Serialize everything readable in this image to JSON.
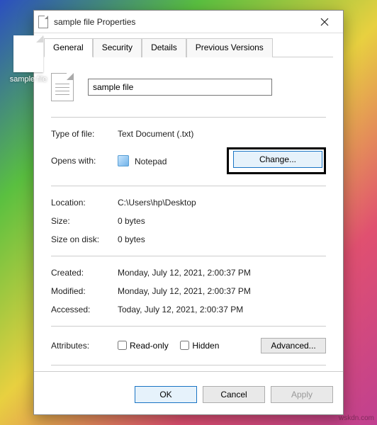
{
  "desktop": {
    "file_label": "sample file"
  },
  "window": {
    "title": "sample file Properties",
    "tabs": [
      "General",
      "Security",
      "Details",
      "Previous Versions"
    ]
  },
  "general": {
    "filename": "sample file",
    "type_label": "Type of file:",
    "type_value": "Text Document (.txt)",
    "opens_label": "Opens with:",
    "opens_value": "Notepad",
    "change_btn": "Change...",
    "location_label": "Location:",
    "location_value": "C:\\Users\\hp\\Desktop",
    "size_label": "Size:",
    "size_value": "0 bytes",
    "sizeondisk_label": "Size on disk:",
    "sizeondisk_value": "0 bytes",
    "created_label": "Created:",
    "created_value": "Monday, July 12, 2021, 2:00:37 PM",
    "modified_label": "Modified:",
    "modified_value": "Monday, July 12, 2021, 2:00:37 PM",
    "accessed_label": "Accessed:",
    "accessed_value": "Today, July 12, 2021, 2:00:37 PM",
    "attributes_label": "Attributes:",
    "readonly_label": "Read-only",
    "hidden_label": "Hidden",
    "advanced_btn": "Advanced..."
  },
  "footer": {
    "ok": "OK",
    "cancel": "Cancel",
    "apply": "Apply"
  },
  "watermark": "wskdn.com"
}
